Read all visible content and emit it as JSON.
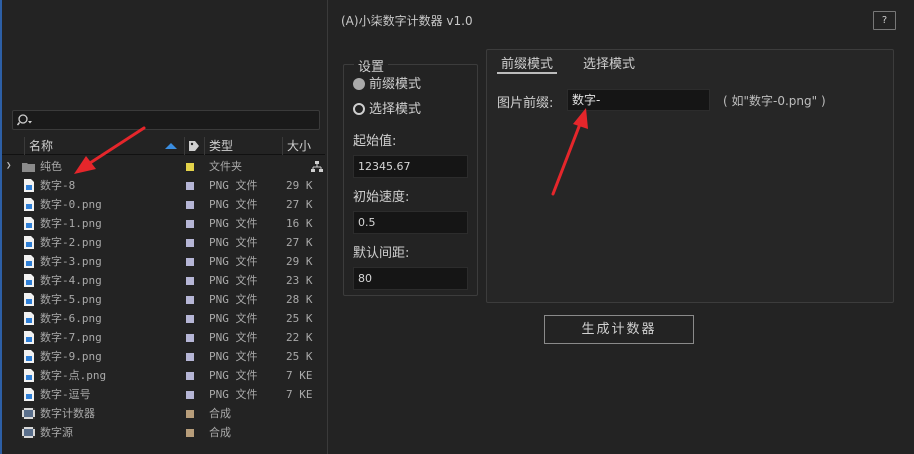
{
  "project": {
    "search": {
      "placeholder": ""
    },
    "columns": {
      "name": "名称",
      "type": "类型",
      "size": "大小"
    },
    "items": [
      {
        "name": "纯色",
        "type": "文件夹",
        "size": "",
        "kind": "folder",
        "swatch": "#e3d34a"
      },
      {
        "name": "数字-8",
        "type": "PNG 文件",
        "size": "29 K",
        "kind": "png",
        "swatch": "#b6b6d6"
      },
      {
        "name": "数字-0.png",
        "type": "PNG 文件",
        "size": "27 K",
        "kind": "png",
        "swatch": "#b6b6d6"
      },
      {
        "name": "数字-1.png",
        "type": "PNG 文件",
        "size": "16 K",
        "kind": "png",
        "swatch": "#b6b6d6"
      },
      {
        "name": "数字-2.png",
        "type": "PNG 文件",
        "size": "27 K",
        "kind": "png",
        "swatch": "#b6b6d6"
      },
      {
        "name": "数字-3.png",
        "type": "PNG 文件",
        "size": "29 K",
        "kind": "png",
        "swatch": "#b6b6d6"
      },
      {
        "name": "数字-4.png",
        "type": "PNG 文件",
        "size": "23 K",
        "kind": "png",
        "swatch": "#b6b6d6"
      },
      {
        "name": "数字-5.png",
        "type": "PNG 文件",
        "size": "28 K",
        "kind": "png",
        "swatch": "#b6b6d6"
      },
      {
        "name": "数字-6.png",
        "type": "PNG 文件",
        "size": "25 K",
        "kind": "png",
        "swatch": "#b6b6d6"
      },
      {
        "name": "数字-7.png",
        "type": "PNG 文件",
        "size": "22 K",
        "kind": "png",
        "swatch": "#b6b6d6"
      },
      {
        "name": "数字-9.png",
        "type": "PNG 文件",
        "size": "25 K",
        "kind": "png",
        "swatch": "#b6b6d6"
      },
      {
        "name": "数字-点.png",
        "type": "PNG 文件",
        "size": "7 KE",
        "kind": "png",
        "swatch": "#b6b6d6"
      },
      {
        "name": "数字-逗号",
        "type": "PNG 文件",
        "size": "7 KE",
        "kind": "png",
        "swatch": "#b6b6d6"
      },
      {
        "name": "数字计数器",
        "type": "合成",
        "size": "",
        "kind": "comp",
        "swatch": "#b79d7a"
      },
      {
        "name": "数字源",
        "type": "合成",
        "size": "",
        "kind": "comp",
        "swatch": "#b79d7a"
      }
    ]
  },
  "plugin": {
    "title": "(A)小柒数字计数器 v1.0",
    "help_label": "?",
    "settings": {
      "legend": "设置",
      "mode_prefix": "前缀模式",
      "mode_select": "选择模式",
      "start_label": "起始值:",
      "start_value": "12345.67",
      "speed_label": "初始速度:",
      "speed_value": "0.5",
      "spacing_label": "默认间距:",
      "spacing_value": "80"
    },
    "tabs": {
      "prefix": "前缀模式",
      "select": "选择模式"
    },
    "prefix_label": "图片前缀:",
    "prefix_value": "数字-",
    "prefix_hint": "( 如\"数字-0.png\" )",
    "generate_label": "生成计数器"
  },
  "colors": {
    "accent_blue": "#2d5fa6",
    "arrow_red": "#e5262b",
    "folder_yellow": "#e3d34a",
    "png_lavender": "#b6b6d6",
    "comp_tan": "#b79d7a"
  }
}
